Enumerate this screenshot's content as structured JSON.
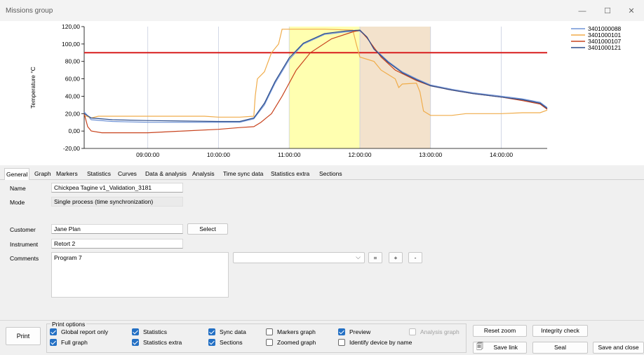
{
  "window": {
    "title": "Missions group",
    "minimize": "—",
    "maximize": "☐",
    "close": "✕"
  },
  "chart_data": {
    "type": "line",
    "ylabel": "Temperature °C",
    "ylim": [
      -20,
      120
    ],
    "yticks": [
      "120,00",
      "100,00",
      "80,00",
      "60,00",
      "40,00",
      "20,00",
      "0,00",
      "-20,00"
    ],
    "xticks": [
      "09:00:00",
      "10:00:00",
      "11:00:00",
      "12:00:00",
      "13:00:00",
      "14:00:00"
    ],
    "xlim_hours": [
      8.1,
      14.65
    ],
    "threshold": {
      "value": 90,
      "color": "#d81e1e"
    },
    "bands": [
      {
        "from_h": 11.0,
        "to_h": 12.0,
        "color": "#ffffb0"
      },
      {
        "from_h": 12.0,
        "to_h": 13.0,
        "color": "#f3e2cc"
      }
    ],
    "series": [
      {
        "name": "3401000088",
        "color": "#6f93d6",
        "points": [
          [
            8.1,
            22
          ],
          [
            8.2,
            13
          ],
          [
            8.5,
            11
          ],
          [
            9.0,
            10
          ],
          [
            10.0,
            10
          ],
          [
            10.3,
            10
          ],
          [
            10.5,
            14
          ],
          [
            10.65,
            30
          ],
          [
            10.8,
            55
          ],
          [
            11.0,
            82
          ],
          [
            11.2,
            100
          ],
          [
            11.5,
            111
          ],
          [
            11.8,
            114
          ],
          [
            12.0,
            115
          ],
          [
            12.1,
            108
          ],
          [
            12.2,
            95
          ],
          [
            12.4,
            80
          ],
          [
            12.6,
            68
          ],
          [
            12.8,
            60
          ],
          [
            13.0,
            53
          ],
          [
            13.3,
            48
          ],
          [
            13.6,
            44
          ],
          [
            14.0,
            40
          ],
          [
            14.3,
            37
          ],
          [
            14.55,
            33
          ],
          [
            14.65,
            27
          ]
        ]
      },
      {
        "name": "3401000101",
        "color": "#f0ac4a",
        "points": [
          [
            8.1,
            18
          ],
          [
            8.2,
            15
          ],
          [
            8.3,
            17
          ],
          [
            9.0,
            17
          ],
          [
            9.8,
            17
          ],
          [
            10.0,
            16
          ],
          [
            10.3,
            16
          ],
          [
            10.5,
            17
          ],
          [
            10.52,
            40
          ],
          [
            10.55,
            60
          ],
          [
            10.65,
            68
          ],
          [
            10.75,
            90
          ],
          [
            10.85,
            100
          ],
          [
            10.9,
            117
          ],
          [
            11.0,
            117
          ],
          [
            11.5,
            117
          ],
          [
            11.9,
            116
          ],
          [
            11.95,
            100
          ],
          [
            12.0,
            85
          ],
          [
            12.2,
            80
          ],
          [
            12.3,
            70
          ],
          [
            12.4,
            65
          ],
          [
            12.5,
            60
          ],
          [
            12.55,
            50
          ],
          [
            12.6,
            54
          ],
          [
            12.8,
            55
          ],
          [
            12.85,
            45
          ],
          [
            12.9,
            23
          ],
          [
            13.0,
            18
          ],
          [
            13.3,
            18
          ],
          [
            13.5,
            20
          ],
          [
            14.0,
            20
          ],
          [
            14.3,
            21
          ],
          [
            14.55,
            21
          ],
          [
            14.65,
            24
          ]
        ]
      },
      {
        "name": "3401000107",
        "color": "#c8431e",
        "points": [
          [
            8.1,
            20
          ],
          [
            8.15,
            5
          ],
          [
            8.2,
            0
          ],
          [
            8.35,
            -2
          ],
          [
            9.0,
            -2
          ],
          [
            9.5,
            0
          ],
          [
            10.0,
            2
          ],
          [
            10.3,
            4
          ],
          [
            10.5,
            5
          ],
          [
            10.6,
            10
          ],
          [
            10.75,
            20
          ],
          [
            10.9,
            40
          ],
          [
            11.1,
            70
          ],
          [
            11.3,
            90
          ],
          [
            11.6,
            106
          ],
          [
            11.9,
            114
          ],
          [
            12.0,
            116
          ],
          [
            12.1,
            107
          ],
          [
            12.3,
            85
          ],
          [
            12.5,
            70
          ],
          [
            12.8,
            58
          ],
          [
            13.0,
            52
          ],
          [
            13.3,
            47
          ],
          [
            13.6,
            43
          ],
          [
            14.0,
            39
          ],
          [
            14.3,
            35
          ],
          [
            14.55,
            31
          ],
          [
            14.65,
            25
          ]
        ]
      },
      {
        "name": "3401000121",
        "color": "#2b4b8a",
        "points": [
          [
            8.1,
            20
          ],
          [
            8.2,
            15
          ],
          [
            8.5,
            13
          ],
          [
            9.0,
            12
          ],
          [
            10.0,
            11
          ],
          [
            10.3,
            11
          ],
          [
            10.5,
            15
          ],
          [
            10.65,
            32
          ],
          [
            10.8,
            57
          ],
          [
            11.0,
            84
          ],
          [
            11.2,
            101
          ],
          [
            11.5,
            112
          ],
          [
            11.8,
            115
          ],
          [
            12.0,
            116
          ],
          [
            12.1,
            108
          ],
          [
            12.2,
            94
          ],
          [
            12.4,
            79
          ],
          [
            12.6,
            67
          ],
          [
            12.8,
            59
          ],
          [
            13.0,
            52
          ],
          [
            13.3,
            47
          ],
          [
            13.6,
            43
          ],
          [
            14.0,
            39
          ],
          [
            14.3,
            36
          ],
          [
            14.55,
            32
          ],
          [
            14.65,
            26
          ]
        ]
      }
    ]
  },
  "tabs": [
    "General",
    "Graph",
    "Markers",
    "Statistics",
    "Curves",
    "Data & analysis",
    "Analysis",
    "Time sync data",
    "Statistics extra",
    "Sections"
  ],
  "general": {
    "name_label": "Name",
    "name_value": "Chickpea Tagine v1_Validation_3181",
    "mode_label": "Mode",
    "mode_value": "Single process (time synchronization)",
    "customer_label": "Customer",
    "customer_value": "Jane Plan",
    "select_button": "Select",
    "instrument_label": "Instrument",
    "instrument_value": "Retort 2",
    "comments_label": "Comments",
    "comments_value": "Program 7",
    "combo_value": "",
    "eq_button": "=",
    "plus_button": "+",
    "minus_button": "-"
  },
  "bottom": {
    "print_button": "Print",
    "print_options_title": "Print options",
    "options": [
      {
        "label": "Global report only",
        "checked": true,
        "disabled": false
      },
      {
        "label": "Full graph",
        "checked": true,
        "disabled": false
      },
      {
        "label": "Statistics",
        "checked": true,
        "disabled": false
      },
      {
        "label": "Statistics extra",
        "checked": true,
        "disabled": false
      },
      {
        "label": "Sync data",
        "checked": true,
        "disabled": false
      },
      {
        "label": "Sections",
        "checked": true,
        "disabled": false
      },
      {
        "label": "Markers graph",
        "checked": false,
        "disabled": false
      },
      {
        "label": "Zoomed graph",
        "checked": false,
        "disabled": false
      },
      {
        "label": "Preview",
        "checked": true,
        "disabled": false
      },
      {
        "label": "Identify device by name",
        "checked": false,
        "disabled": false
      },
      {
        "label": "Analysis graph",
        "checked": false,
        "disabled": true
      }
    ],
    "reset_zoom": "Reset zoom",
    "integrity_check": "Integrity check",
    "save_link": "Save link",
    "seal": "Seal",
    "save_and_close": "Save and close"
  }
}
